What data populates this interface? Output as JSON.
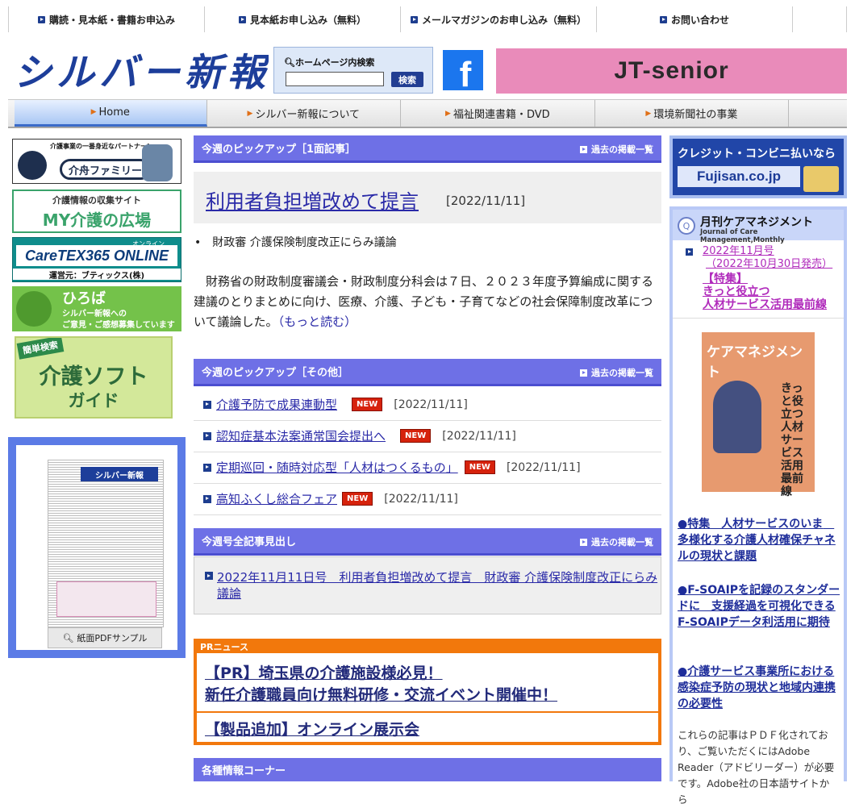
{
  "top_links": [
    "購読・見本紙・書籍お申込み",
    "見本紙お申し込み（無料）",
    "メールマガジンのお申し込み（無料）",
    "お問い合わせ"
  ],
  "header": {
    "logo": "シルバー新報",
    "search_label": "ホームページ内検索",
    "search_placeholder": "",
    "search_button": "検索",
    "facebook_glyph": "f",
    "banner_text": "JT-senior"
  },
  "nav": [
    "Home",
    "シルバー新報について",
    "福祉関連書籍・DVD",
    "環境新聞社の事業"
  ],
  "left": {
    "banners": [
      {
        "line1": "介護事業の一番身近なパートナー!",
        "line2": "介舟ファミリー"
      },
      {
        "line1": "介護情報の収集サイト",
        "line2": "MY介護の広場"
      },
      {
        "line1": "CareTEX365 ONLINE",
        "line2": "運営元：ブティックス(株)",
        "badge": "オンライン"
      },
      {
        "line1": "ひろば",
        "line2": "シルバー新報への",
        "line3": "ご意見・ご感想募集しています"
      },
      {
        "line1": "簡単検索",
        "line2": "介護ソフト",
        "line3": "ガイド"
      }
    ],
    "pdf_label": "紙面PDFサンプル"
  },
  "main": {
    "pickup_top": {
      "heading": "今週のピックアップ［1面記事］",
      "more": "過去の掲載一覧",
      "title": "利用者負担増改めて提言",
      "date": "[2022/11/11]",
      "subtitle": "財政審 介護保険制度改正にらみ議論",
      "body": "　財務省の財政制度審議会・財政制度分科会は７日、２０２３年度予算編成に関する建議のとりまとめに向け、医療、介護、子ども・子育てなどの社会保障制度改革について議論した。",
      "read_more": "（もっと読む）"
    },
    "pickup_other": {
      "heading": "今週のピックアップ［その他］",
      "more": "過去の掲載一覧",
      "new_label": "NEW",
      "items": [
        {
          "title": "介護予防で成果連動型",
          "date": "[2022/11/11]"
        },
        {
          "title": "認知症基本法案通常国会提出へ",
          "date": "[2022/11/11]"
        },
        {
          "title": "定期巡回・随時対応型「人材はつくるもの」",
          "date": "[2022/11/11]"
        },
        {
          "title": "高知ふくし総合フェア",
          "date": "[2022/11/11]"
        }
      ]
    },
    "all_headlines": {
      "heading": "今週号全記事見出し",
      "more": "過去の掲載一覧",
      "text": "2022年11月11日号　利用者負担増改めて提言　財政審 介護保険制度改正にらみ議論"
    },
    "pr": {
      "heading": "PRニュース",
      "item1_line1": "【PR】埼玉県の介護施設様必見！",
      "item1_line2": "新任介護職員向け無料研修・交流イベント開催中！",
      "item2": "【製品追加】オンライン展示会"
    },
    "info_heading": "各種情報コーナー"
  },
  "right": {
    "banner_line1": "クレジット・コンビニ払いなら",
    "banner_line2": "Fujisan.co.jp",
    "cm": {
      "title_jp": "月刊ケアマネジメント",
      "title_en": "Journal of Care Management,Monthly",
      "issue": "2022年11月号",
      "issue_release": "（2022年10月30日発売）",
      "feature_label": "【特集】",
      "feature_line1": "きっと役立つ",
      "feature_line2": "人材サービス活用最前線",
      "cover_title": "ケアマネジメント",
      "cover_vertical": "きっと役立つ人材サービス活用最前線",
      "articles": [
        "●特集　人材サービスのいま　多様化する介護人材確保チャネルの現状と課題",
        "●F-SOAIPを記録のスタンダードに　支援経過を可視化できるF-SOAIPデータ利活用に期待",
        "●介護サービス事業所における感染症予防の現状と地域内連携の必要性"
      ],
      "note": "これらの記事はＰＤＦ化されており、ご覧いただくにはAdobe Reader（アドビリーダー）が必要です。Adobe社の日本語サイトから"
    }
  },
  "colors": {
    "accent_blue": "#6e70e6",
    "pr_orange": "#f2780c",
    "new_red": "#d6220c",
    "link": "#2a2aa8"
  }
}
